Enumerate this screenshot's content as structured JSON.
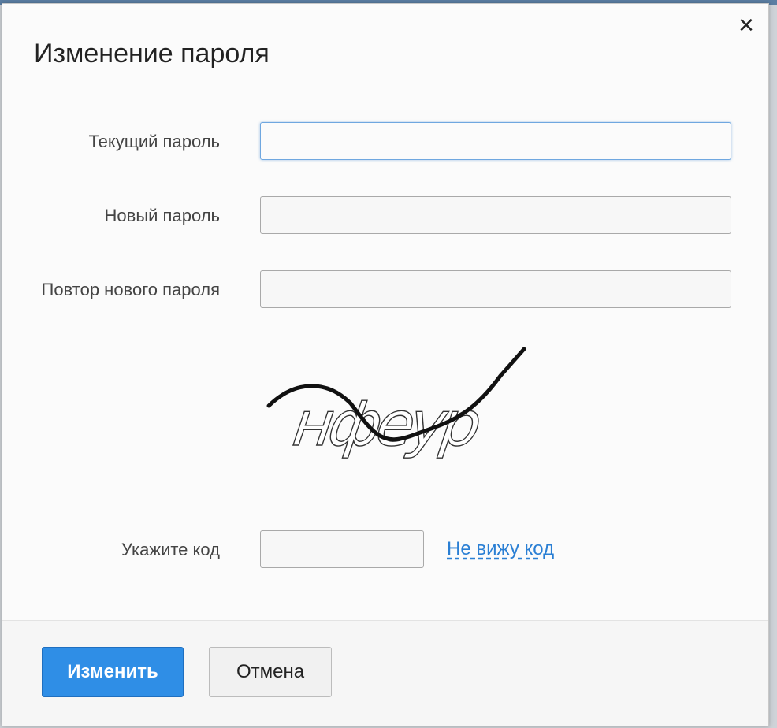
{
  "dialog": {
    "title": "Изменение пароля",
    "close_icon": "close-icon",
    "close_glyph": "✕"
  },
  "fields": {
    "current_password": {
      "label": "Текущий пароль",
      "value": ""
    },
    "new_password": {
      "label": "Новый пароль",
      "value": ""
    },
    "repeat_password": {
      "label": "Повтор нового пароля",
      "value": ""
    }
  },
  "captcha": {
    "text": "нфеур",
    "code_label": "Укажите код",
    "code_value": "",
    "cant_see_link": "Не вижу код"
  },
  "buttons": {
    "submit": "Изменить",
    "cancel": "Отмена"
  },
  "colors": {
    "primary": "#2f8ee6",
    "link": "#2a7fd4",
    "focus": "#6fa7e0"
  }
}
